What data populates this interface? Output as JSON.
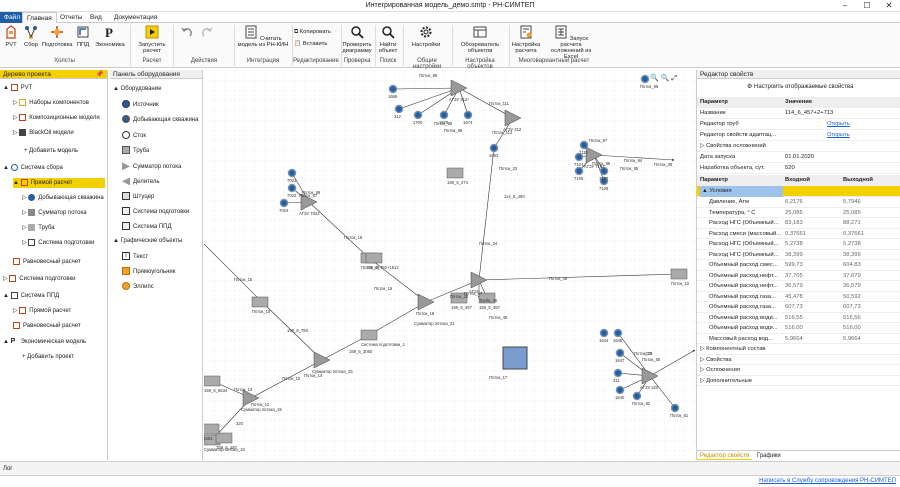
{
  "window": {
    "title": "Интегрированная модель_демо.smtp - РН-СИМТЕП",
    "minimize": "–",
    "maximize": "☐",
    "close": "✕"
  },
  "menu": {
    "file": "Файл",
    "tabs": [
      "Главная",
      "Отчеты",
      "Вид",
      "Документация"
    ]
  },
  "ribbon": {
    "buttons": [
      "РVT",
      "Сбор",
      "Подготовка",
      "ППД",
      "Экономика",
      "Запустить расчет",
      "Считать модель из РН-КИН",
      "Копировать",
      "Вставить",
      "Проверить диаграмму",
      "Найти объект",
      "Настройки",
      "Обозреватель объектов",
      "Настройка расчета",
      "Запуск расчета осложнений из Excel"
    ],
    "groups": [
      "Холсты",
      "Расчет",
      "Действия",
      "Интеграция",
      "Редактирование",
      "Проверка",
      "Поиск",
      "Общие настройки",
      "Настройка объектов",
      "Многовариантный расчет"
    ]
  },
  "tree": {
    "header": "Дерево проекта",
    "items": [
      "PVT",
      "Наборы компонентов",
      "Композиционные модели",
      "BlackOil модели",
      "Добавить модель",
      "Система сбора",
      "Прямой расчет",
      "Добывающая скважина",
      "Сумматор потока",
      "Труба",
      "Система подготовки",
      "Равновесный расчет",
      "Система подготовки",
      "Система ППД",
      "Прямой расчет",
      "Равновесный расчет",
      "Экономическая модель",
      "Добавить проект"
    ]
  },
  "palette": {
    "header": "Панель оборудования",
    "section1": "Оборудование",
    "items": [
      "Источник",
      "Добывающая скважина",
      "Сток",
      "Труба",
      "Сумматор потока",
      "Делитель",
      "Штуцер",
      "Система подготовки",
      "Система ППД"
    ],
    "section2": "Графические объекты",
    "graphics": [
      "Текст",
      "Прямоугольник",
      "Эллипс"
    ]
  },
  "canvas": {
    "labels": [
      "1666",
      "Поток_89",
      "Поток_88",
      "Поток_86",
      "1676",
      "1674",
      "1700",
      "312",
      "АГЗУ 312*",
      "Поток_111",
      "Поток_112",
      "АГЗУ 312",
      "1663",
      "1670",
      "Поток_23",
      "114_5_490",
      "7110",
      "7101",
      "7105",
      "7107",
      "7106",
      "Поток_97",
      "Поток_96",
      "Поток_95",
      "Поток_94",
      "АГЗУ 7107",
      "Поток_35",
      "7023",
      "7022",
      "7024",
      "Поток_69",
      "Поток_67",
      "АГЗУ 7022",
      "Поток_19",
      "114_6_457+2+713",
      "Поток_24",
      "Поток_15",
      "159_6_750",
      "Поток_20",
      "Поток_16",
      "Сумматор потока_31",
      "Поток_18",
      "Поток_22",
      "159_6_274",
      "Поток_47",
      "Труба_45",
      "Поток_46",
      "219_8_114",
      "АГЗУ",
      "Поток_48",
      "Система подготовки_1",
      "Поток_17",
      "159_6_3050",
      "Сумматор потока_25",
      "159_6_450+1512",
      "Поток_14",
      "Поток_10",
      "Поток_13",
      "159_6_5534",
      "Сумматор потока_19",
      "Поток_12",
      "159_6_487",
      "320",
      "1644",
      "1645",
      "1647",
      "311",
      "1640",
      "Поток_82",
      "Поток_81",
      "Поток_80",
      "Поток_79",
      "АГЗУ 320",
      "-319"
    ],
    "zoom": [
      "🔍",
      "🔍",
      "⤢"
    ]
  },
  "props": {
    "header": "Редактор свойств",
    "configure": "Настроить отображаемые свойства",
    "col_param": "Параметр",
    "col_value": "Значение",
    "rows": [
      [
        "Название",
        "114_6_457+2+713"
      ],
      [
        "Редактор труб",
        "Открыть"
      ],
      [
        "Редактор свойств адаптац...",
        "Открыть"
      ],
      [
        "Свойства осложнений",
        ""
      ],
      [
        "Дата запуска",
        "01.01.2020"
      ],
      [
        "Наработка объекта, сут.",
        "520"
      ]
    ],
    "col_in": "Входной",
    "col_out": "Выходной",
    "cond": "Условия",
    "table": [
      [
        "Давление, Атм",
        "6,2176",
        "5,7946"
      ],
      [
        "Температура, ° С",
        "25,085",
        "25,085"
      ],
      [
        "Расход НГС (Объемный...",
        "83,183",
        "88,271"
      ],
      [
        "Расход смеси (массовый...",
        "0,37661",
        "0,37661"
      ],
      [
        "Расход НГС (Объемный...",
        "5,2738",
        "5,2738"
      ],
      [
        "Расход НГС (Объемный...",
        "38,399",
        "38,399"
      ],
      [
        "Объемный расход смес...",
        "599,73",
        "604,83"
      ],
      [
        "Объемный расход нефт...",
        "37,705",
        "37,679"
      ],
      [
        "Объемный расход нефт...",
        "36,579",
        "36,579"
      ],
      [
        "Объемный расход газа...",
        "45,478",
        "50,592"
      ],
      [
        "Объемный расход газа...",
        "607,73",
        "607,73"
      ],
      [
        "Объемный расход води...",
        "516,55",
        "516,56"
      ],
      [
        "Объемный расход води...",
        "516,00",
        "516,00"
      ],
      [
        "Массовый расход вод...",
        "5,9664",
        "5,9664"
      ]
    ],
    "groups": [
      "Компонентный состав",
      "Свойства",
      "Осложнения",
      "Дополнительные"
    ],
    "tabs": [
      "Редактор свойств",
      "Графики"
    ]
  },
  "log": "Лог",
  "status": "Написать в Службу сопровождения РН-СИМТЕП",
  "colors": {
    "accent": "#f5d000",
    "blue": "#1f5fa8",
    "link": "#1a5fd0"
  }
}
